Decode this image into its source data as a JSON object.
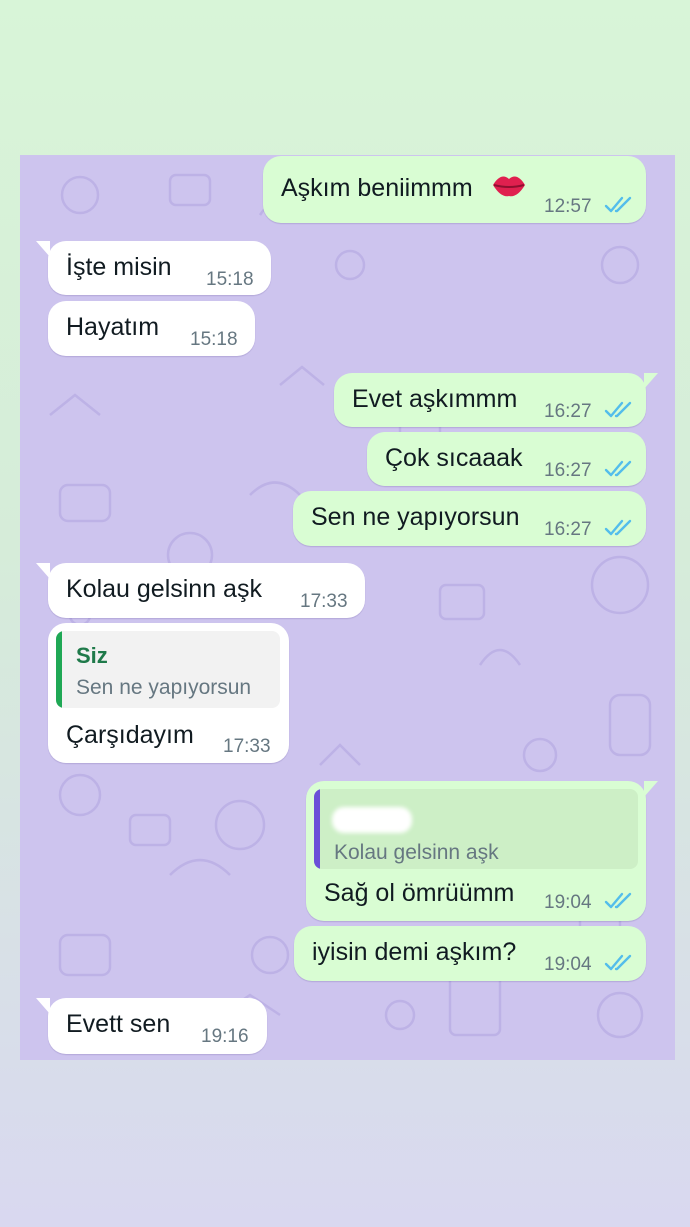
{
  "colors": {
    "incoming_bg": "#ffffff",
    "outgoing_bg": "#d9fdd3",
    "chat_bg": "#cdc4ee",
    "read_tick": "#53bdeb",
    "quote_green": "#1fa855",
    "quote_purple": "#6b4fd8"
  },
  "messages": [
    {
      "direction": "out",
      "text": "Aşkım beniimmm",
      "emoji": "kiss-lips-icon",
      "time": "12:57",
      "status": "read"
    },
    {
      "direction": "in",
      "text": "İşte misin",
      "time": "15:18"
    },
    {
      "direction": "in",
      "text": "Hayatım",
      "time": "15:18"
    },
    {
      "direction": "out",
      "text": "Evet aşkımmm",
      "time": "16:27",
      "status": "read"
    },
    {
      "direction": "out",
      "text": "Çok sıcaaak",
      "time": "16:27",
      "status": "read"
    },
    {
      "direction": "out",
      "text": "Sen ne yapıyorsun",
      "time": "16:27",
      "status": "read"
    },
    {
      "direction": "in",
      "text": "Kolau gelsinn aşk",
      "time": "17:33"
    },
    {
      "direction": "in",
      "text": "Çarşıdayım",
      "time": "17:33",
      "quote": {
        "author": "Siz",
        "text": "Sen ne yapıyorsun"
      }
    },
    {
      "direction": "out",
      "text": "Sağ ol ömrüümm",
      "time": "19:04",
      "status": "read",
      "quote": {
        "author": "",
        "text": "Kolau gelsinn aşk"
      }
    },
    {
      "direction": "out",
      "text": "iyisin demi aşkım?",
      "time": "19:04",
      "status": "read"
    },
    {
      "direction": "in",
      "text": "Evett sen",
      "time": "19:16"
    }
  ]
}
